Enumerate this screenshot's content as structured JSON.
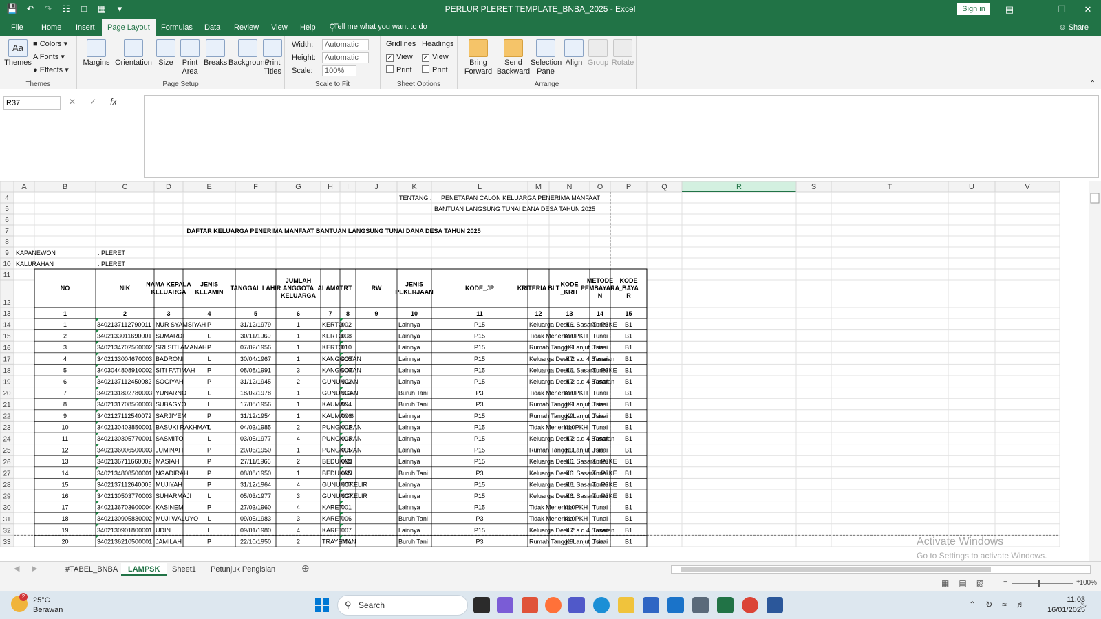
{
  "title": "PERLUR PLERET TEMPLATE_BNBA_2025  -  Excel",
  "signin": "Sign in",
  "tabs": [
    "File",
    "Home",
    "Insert",
    "Page Layout",
    "Formulas",
    "Data",
    "Review",
    "View",
    "Help"
  ],
  "active_tab": "Page Layout",
  "tell_me": "Tell me what you want to do",
  "share": "Share",
  "ribbon": {
    "themes": {
      "themes": "Themes",
      "colors": "Colors",
      "fonts": "Fonts",
      "effects": "Effects",
      "label": "Themes"
    },
    "page_setup": {
      "margins": "Margins",
      "orientation": "Orientation",
      "size": "Size",
      "print_area": "Print Area",
      "breaks": "Breaks",
      "background": "Background",
      "print_titles": "Print Titles",
      "label": "Page Setup"
    },
    "scale": {
      "width_label": "Width:",
      "width_value": "Automatic",
      "height_label": "Height:",
      "height_value": "Automatic",
      "scale_label": "Scale:",
      "scale_value": "100%",
      "label": "Scale to Fit"
    },
    "sheet_options": {
      "gridlines": "Gridlines",
      "headings": "Headings",
      "view": "View",
      "print": "Print",
      "gridlines_view": true,
      "headings_view": true,
      "label": "Sheet Options"
    },
    "arrange": {
      "bring_forward": "Bring Forward",
      "send_backward": "Send Backward",
      "selection_pane": "Selection Pane",
      "align": "Align",
      "group": "Group",
      "rotate": "Rotate",
      "label": "Arrange"
    }
  },
  "name_box": "R37",
  "formula": "",
  "columns": [
    "A",
    "B",
    "C",
    "D",
    "E",
    "F",
    "G",
    "H",
    "I",
    "J",
    "K",
    "L",
    "M",
    "N",
    "O",
    "P",
    "Q",
    "R",
    "S",
    "T",
    "U",
    "V"
  ],
  "selected_column": "R",
  "sheet": {
    "tentang_label": "TENTANG :",
    "tentang_line1": "PENETAPAN CALON KELUARGA PENERIMA MANFAAT",
    "tentang_line2": "BANTUAN LANGSUNG TUNAI DANA DESA TAHUN 2025",
    "title": "DAFTAR KELUARGA PENERIMA MANFAAT BANTUAN LANGSUNG TUNAI DANA DESA TAHUN 2025",
    "kapanewon_label": "KAPANEWON",
    "kapanewon_value": ": PLERET",
    "kalurahan_label": "KALURAHAN",
    "kalurahan_value": ": PLERET",
    "headers": [
      "NO",
      "NIK",
      "NAMA KEPALA KELUARGA",
      "JENIS KELAMIN",
      "TANGGAL LAHIR",
      "JUMLAH ANGGOTA KELUARGA",
      "ALAMAT",
      "RT",
      "RW",
      "JENIS PEKERJAAN",
      "KODE_JP",
      "KRITERIA BLT",
      "KODE _KRIT",
      "METODE PEMBAYARAN",
      "KODE _BAYAR"
    ],
    "header_numbers": [
      "1",
      "2",
      "3",
      "4",
      "5",
      "6",
      "7",
      "8",
      "9",
      "10",
      "11",
      "12",
      "13",
      "14",
      "15"
    ],
    "rows": [
      [
        "1",
        "3402137112790011",
        "NUR SYAMSIYAH",
        "P",
        "31/12/1979",
        "1",
        "KERTO",
        "002",
        "",
        "Lainnya",
        "P15",
        "Keluarga Desil 1 Sasaran P3KE",
        "K6",
        "Tunai",
        "B1"
      ],
      [
        "2",
        "3402133011690001",
        "SUMARDI",
        "L",
        "30/11/1969",
        "1",
        "KERTO",
        "008",
        "",
        "Lainnya",
        "P15",
        "Tidak Menerima PKH",
        "K10",
        "Tunai",
        "B1"
      ],
      [
        "3",
        "3402134702560002",
        "SRI SITI AMANAH",
        "P",
        "07/02/1956",
        "1",
        "KERTO",
        "010",
        "",
        "Lainnya",
        "P15",
        "Rumah Tangga Lanjut Usia",
        "K9",
        "Tunai",
        "B1"
      ],
      [
        "4",
        "3402133004670003",
        "BADRONI",
        "L",
        "30/04/1967",
        "1",
        "KANGGOTAN",
        "005",
        "",
        "Lainnya",
        "P15",
        "Keluarga Desil 2 s.d 4 Sasaran",
        "K7",
        "Tunai",
        "B1"
      ],
      [
        "5",
        "3403044808910002",
        "SITI FATIMAH",
        "P",
        "08/08/1991",
        "3",
        "KANGGOTAN",
        "009",
        "",
        "Lainnya",
        "P15",
        "Keluarga Desil 1 Sasaran P3KE",
        "K6",
        "Tunai",
        "B1"
      ],
      [
        "6",
        "3402137112450082",
        "SOGIYAH",
        "P",
        "31/12/1945",
        "2",
        "GUNUNGAN",
        "002",
        "",
        "Lainnya",
        "P15",
        "Keluarga Desil 2 s.d 4 Sasaran",
        "K7",
        "Tunai",
        "B1"
      ],
      [
        "7",
        "3402131802780003",
        "YUNARNO",
        "L",
        "18/02/1978",
        "1",
        "GUNUNGAN",
        "003",
        "",
        "Buruh Tani",
        "P3",
        "Tidak Menerima PKH",
        "K10",
        "Tunai",
        "B1"
      ],
      [
        "8",
        "3402131708560003",
        "SUBAGYO",
        "L",
        "17/08/1956",
        "1",
        "KAUMAN",
        "004",
        "",
        "Buruh Tani",
        "P3",
        "Rumah Tangga Lanjut Usia",
        "K9",
        "Tunai",
        "B1"
      ],
      [
        "9",
        "3402127112540072",
        "SARJIYEM",
        "P",
        "31/12/1954",
        "1",
        "KAUMAN 6",
        "006",
        "",
        "Lainnya",
        "P15",
        "Rumah Tangga Lanjut Usia",
        "K9",
        "Tunai",
        "B1"
      ],
      [
        "10",
        "3402130403850001",
        "BASUKI RAKHMAT",
        "L",
        "04/03/1985",
        "2",
        "PUNGKURAN",
        "002",
        "",
        "Lainnya",
        "P15",
        "Tidak Menerima PKH",
        "K10",
        "Tunai",
        "B1"
      ],
      [
        "11",
        "3402130305770001",
        "SASMITO",
        "L",
        "03/05/1977",
        "4",
        "PUNGKURAN",
        "003",
        "",
        "Lainnya",
        "P15",
        "Keluarga Desil 2 s.d 4 Sasaran",
        "K7",
        "Tunai",
        "B1"
      ],
      [
        "12",
        "3402136006500003",
        "JUMINAH",
        "P",
        "20/06/1950",
        "1",
        "PUNGKURAN",
        "005",
        "",
        "Lainnya",
        "P15",
        "Rumah Tangga Lanjut Usia",
        "K9",
        "Tunai",
        "B1"
      ],
      [
        "13",
        "3402136711660002",
        "MASIAH",
        "P",
        "27/11/1966",
        "2",
        "BEDUKAN",
        "002",
        "",
        "Lainnya",
        "P15",
        "Keluarga Desil 1 Sasaran P3KE",
        "K6",
        "Tunai",
        "B1"
      ],
      [
        "14",
        "3402134808500001",
        "NGADIRAH",
        "P",
        "08/08/1950",
        "1",
        "BEDUKAN",
        "005",
        "",
        "Buruh Tani",
        "P3",
        "Keluarga Desil 1 Sasaran P3KE",
        "K6",
        "Tunai",
        "B1"
      ],
      [
        "15",
        "3402137112640005",
        "MUJIYAH",
        "P",
        "31/12/1964",
        "4",
        "GUNUNGKELIR",
        "007",
        "",
        "Lainnya",
        "P15",
        "Keluarga Desil 1 Sasaran P3KE",
        "K6",
        "Tunai",
        "B1"
      ],
      [
        "16",
        "3402130503770003",
        "SUHARMAJI",
        "L",
        "05/03/1977",
        "3",
        "GUNUNGKELIR",
        "007",
        "",
        "Lainnya",
        "P15",
        "Keluarga Desil 1 Sasaran P3KE",
        "K6",
        "Tunai",
        "B1"
      ],
      [
        "17",
        "3402136703600004",
        "KASINEM",
        "P",
        "27/03/1960",
        "4",
        "KARET",
        "001",
        "",
        "Lainnya",
        "P15",
        "Tidak Menerima PKH",
        "K10",
        "Tunai",
        "B1"
      ],
      [
        "18",
        "3402130905830002",
        "MUJI WALUYO",
        "L",
        "09/05/1983",
        "3",
        "KARET",
        "006",
        "",
        "Buruh Tani",
        "P3",
        "Tidak Menerima PKH",
        "K10",
        "Tunai",
        "B1"
      ],
      [
        "19",
        "3402130901800001",
        "UDIN",
        "L",
        "09/01/1980",
        "4",
        "KARET",
        "007",
        "",
        "Lainnya",
        "P15",
        "Keluarga Desil 2 s.d 4 Sasaran",
        "K7",
        "Tunai",
        "B1"
      ],
      [
        "20",
        "3402136210500001",
        "JAMILAH",
        "P",
        "22/10/1950",
        "2",
        "TRAYEMAN",
        "001",
        "",
        "Buruh Tani",
        "P3",
        "Rumah Tangga Lanjut Usia",
        "K9",
        "Tunai",
        "B1"
      ]
    ]
  },
  "sheet_tabs": [
    "#TABEL_BNBA",
    "LAMPSK",
    "Sheet1",
    "Petunjuk Pengisian"
  ],
  "active_sheet": "LAMPSK",
  "zoom": "100%",
  "watermark_title": "Activate Windows",
  "watermark_sub": "Go to Settings to activate Windows.",
  "taskbar": {
    "weather_temp": "25°C",
    "weather_desc": "Berawan",
    "weather_badge": "2",
    "search_placeholder": "Search",
    "time": "11:03",
    "date": "16/01/2025"
  },
  "colors": {
    "excel_green": "#217346",
    "grid_line": "#d4d4d4",
    "selected_header": "#d3f0e0"
  }
}
